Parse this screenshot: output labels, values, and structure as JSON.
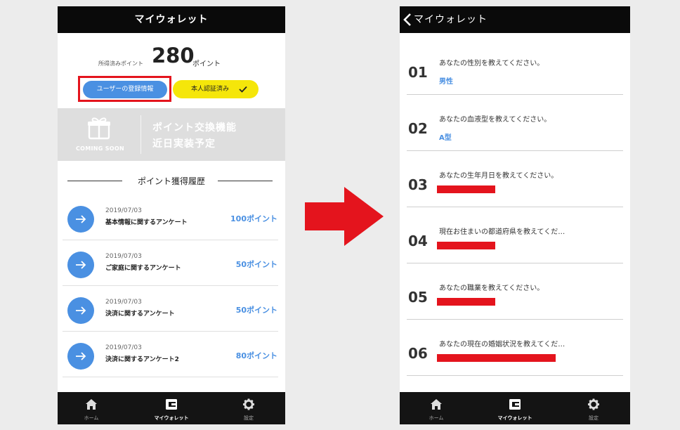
{
  "left_screen": {
    "header_title": "マイウォレット",
    "points_label": "所得済みポイント",
    "points_value": "280",
    "points_unit": "ポイント",
    "registration_button": "ユーザーの登録情報",
    "verified_badge": "本人認証済み",
    "exchange": {
      "coming_soon": "COMING SOON",
      "line1": "ポイント交換機能",
      "line2": "近日実装予定"
    },
    "history_title": "ポイント獲得履歴",
    "history": [
      {
        "date": "2019/07/03",
        "name": "基本情報に関するアンケート",
        "points": "100ポイント"
      },
      {
        "date": "2019/07/03",
        "name": "ご家庭に関するアンケート",
        "points": "50ポイント"
      },
      {
        "date": "2019/07/03",
        "name": "決済に関するアンケート",
        "points": "50ポイント"
      },
      {
        "date": "2019/07/03",
        "name": "決済に関するアンケート2",
        "points": "80ポイント"
      }
    ]
  },
  "right_screen": {
    "header_title": "マイウォレット",
    "questions": [
      {
        "num": "01",
        "question": "あなたの性別を教えてください。",
        "answer": "男性",
        "redacted": false
      },
      {
        "num": "02",
        "question": "あなたの血液型を教えてください。",
        "answer": "A型",
        "redacted": false
      },
      {
        "num": "03",
        "question": "あなたの生年月日を教えてください。",
        "answer": "",
        "redacted": true,
        "redact_fraction": 0.27
      },
      {
        "num": "04",
        "question": "現在お住まいの都道府県を教えてくだ…",
        "answer": "",
        "redacted": true,
        "redact_fraction": 0.27
      },
      {
        "num": "05",
        "question": "あなたの職業を教えてください。",
        "answer": "",
        "redacted": true,
        "redact_fraction": 0.27
      },
      {
        "num": "06",
        "question": "あなたの現在の婚姻状況を教えてくだ…",
        "answer": "",
        "redacted": true,
        "redact_fraction": 0.55
      }
    ]
  },
  "bottom_nav": [
    {
      "label": "ホーム",
      "icon": "home-icon",
      "active": false
    },
    {
      "label": "マイウォレット",
      "icon": "wallet-icon",
      "active": true
    },
    {
      "label": "設定",
      "icon": "gear-icon",
      "active": false
    }
  ],
  "colors": {
    "accent_blue": "#4a90e2",
    "highlight_red": "#e4141d",
    "verify_yellow": "#f5e60a",
    "bar_black": "#0a0a0a"
  }
}
